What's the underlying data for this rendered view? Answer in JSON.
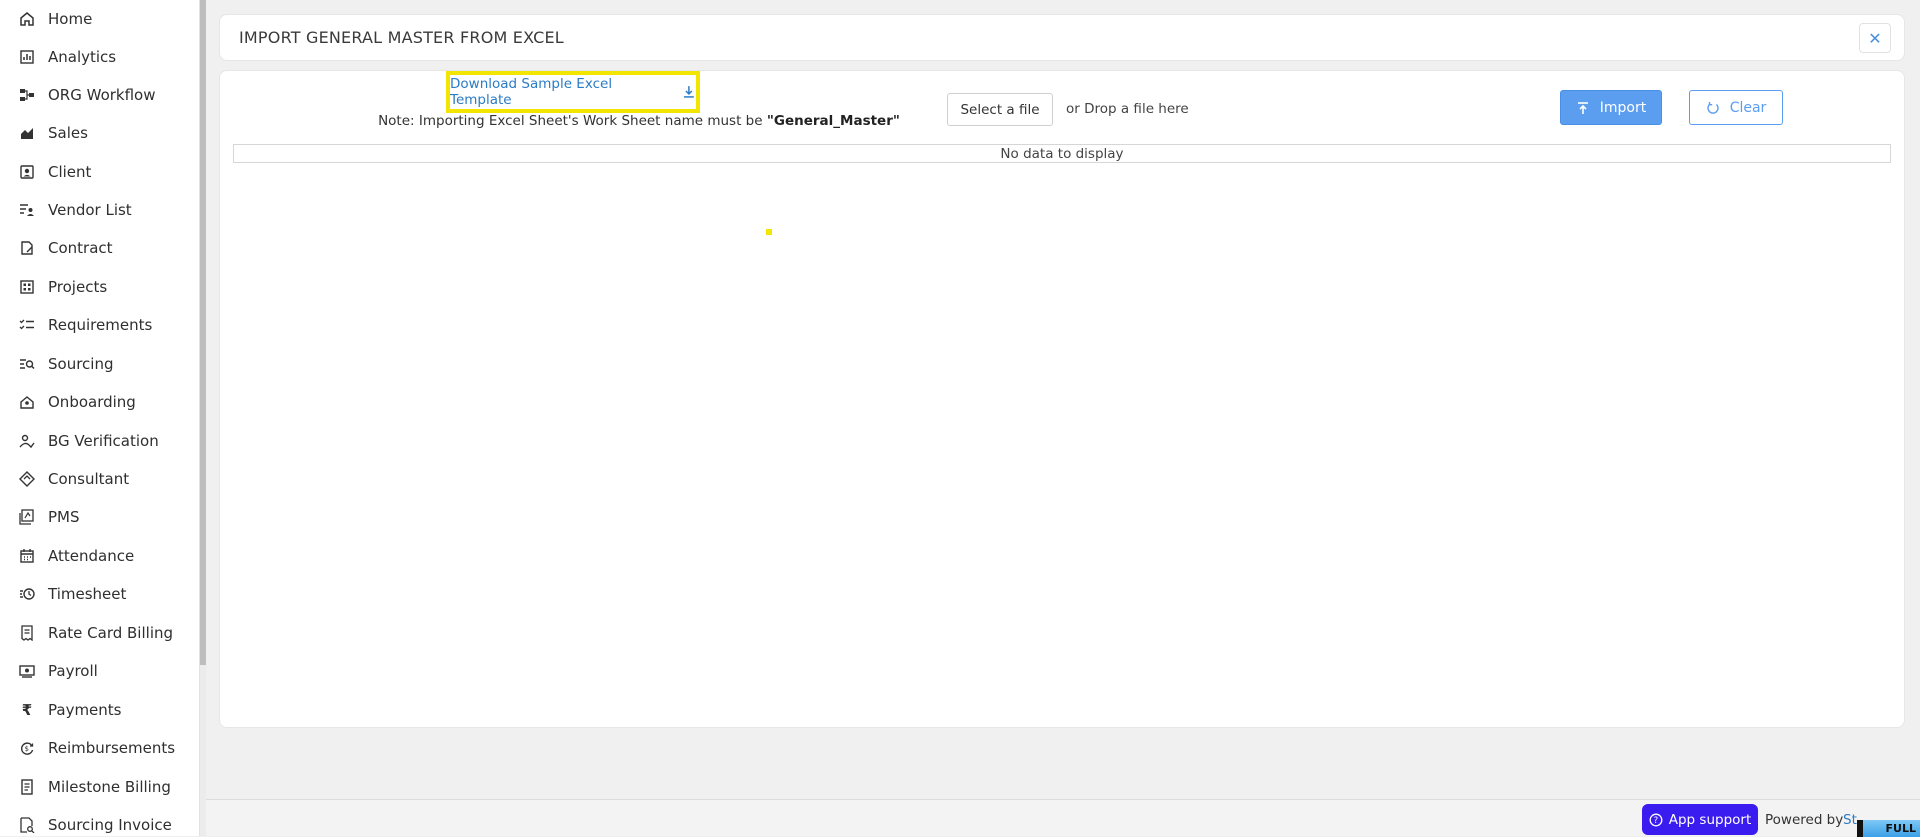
{
  "sidebar": {
    "items": [
      {
        "label": "Home",
        "icon": "home-icon"
      },
      {
        "label": "Analytics",
        "icon": "analytics-icon"
      },
      {
        "label": "ORG Workflow",
        "icon": "workflow-icon"
      },
      {
        "label": "Sales",
        "icon": "sales-icon"
      },
      {
        "label": "Client",
        "icon": "client-icon"
      },
      {
        "label": "Vendor List",
        "icon": "vendor-list-icon"
      },
      {
        "label": "Contract",
        "icon": "contract-icon"
      },
      {
        "label": "Projects",
        "icon": "projects-icon"
      },
      {
        "label": "Requirements",
        "icon": "requirements-icon"
      },
      {
        "label": "Sourcing",
        "icon": "sourcing-icon"
      },
      {
        "label": "Onboarding",
        "icon": "onboarding-icon"
      },
      {
        "label": "BG Verification",
        "icon": "bg-verification-icon"
      },
      {
        "label": "Consultant",
        "icon": "consultant-icon"
      },
      {
        "label": "PMS",
        "icon": "pms-icon"
      },
      {
        "label": "Attendance",
        "icon": "attendance-icon"
      },
      {
        "label": "Timesheet",
        "icon": "timesheet-icon"
      },
      {
        "label": "Rate Card Billing",
        "icon": "rate-card-icon"
      },
      {
        "label": "Payroll",
        "icon": "payroll-icon"
      },
      {
        "label": "Payments",
        "icon": "rupee-icon"
      },
      {
        "label": "Reimbursements",
        "icon": "reimbursements-icon"
      },
      {
        "label": "Milestone Billing",
        "icon": "milestone-icon"
      },
      {
        "label": "Sourcing Invoice",
        "icon": "sourcing-invoice-icon"
      }
    ]
  },
  "header": {
    "title": "IMPORT GENERAL MASTER FROM EXCEL",
    "close_glyph": "✕"
  },
  "import_panel": {
    "download_label": "Download Sample Excel Template",
    "note_prefix": "Note: Importing Excel Sheet's Work Sheet name must be ",
    "note_sheet_name": "\"General_Master\"",
    "select_file_label": "Select a file",
    "drop_text": "or Drop a file here",
    "import_label": "Import",
    "clear_label": "Clear",
    "empty_grid_text": "No data to display"
  },
  "footer": {
    "app_support_label": "App support",
    "powered_by": "Powered by",
    "powered_link": "St",
    "badge": "FULL"
  },
  "colors": {
    "accent": "#5b9ef0",
    "highlight": "#f2e600",
    "support": "#3a1cf0"
  }
}
